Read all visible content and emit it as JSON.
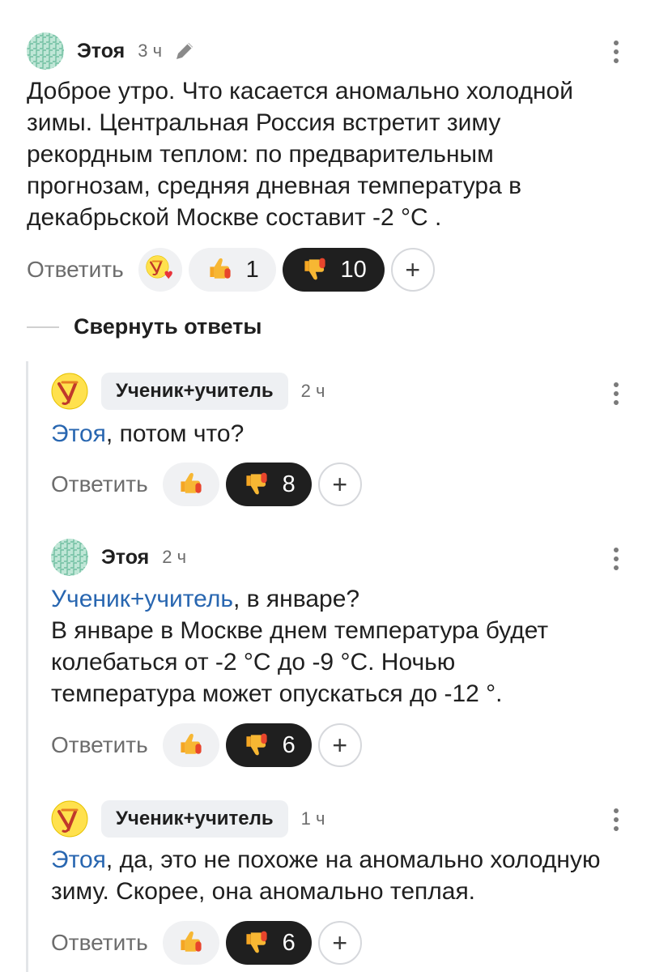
{
  "comments": [
    {
      "author": "Этоя",
      "time": "3 ч",
      "text_lines": [
        "Доброе утро. Что касается аномально холодной",
        "зимы. Центральная Россия встретит зиму",
        "рекордным теплом: по предварительным",
        "прогнозам, средняя дневная температура в",
        "декабрьской Москве составит -2 °С ."
      ],
      "reply_label": "Ответить",
      "likes": "1",
      "dislikes": "10",
      "plus": "+"
    },
    {
      "author": "Ученик+учитель",
      "time": "2 ч",
      "mention": "Этоя",
      "text_rest": ", потом что?",
      "reply_label": "Ответить",
      "dislikes": "8",
      "plus": "+"
    },
    {
      "author": "Этоя",
      "time": "2 ч",
      "mention": "Ученик+учитель",
      "text_rest": ", в январе?",
      "text_lines": [
        "В январе в Москве днем температура будет",
        "колебаться от -2 °С до -9 °С. Ночью",
        "температура может опускаться до -12 °."
      ],
      "reply_label": "Ответить",
      "dislikes": "6",
      "plus": "+"
    },
    {
      "author": "Ученик+учитель",
      "time": "1 ч",
      "mention": "Этоя",
      "text_rest": ", да, это не похоже на аномально холодную",
      "text_line2": "зиму. Скорее, она аномально теплая.",
      "reply_label": "Ответить",
      "dislikes": "6",
      "plus": "+"
    }
  ],
  "collapse_label": "Свернуть ответы",
  "colors": {
    "mention": "#2866b0",
    "dark_pill": "#1f1f1f",
    "light_pill": "#f0f1f3",
    "avatar_teal": "#a8dcc9"
  },
  "icons": [
    "edit-icon",
    "more-vertical-icon",
    "thumbs-up-icon",
    "thumbs-down-icon",
    "heart-icon",
    "plus-icon"
  ]
}
